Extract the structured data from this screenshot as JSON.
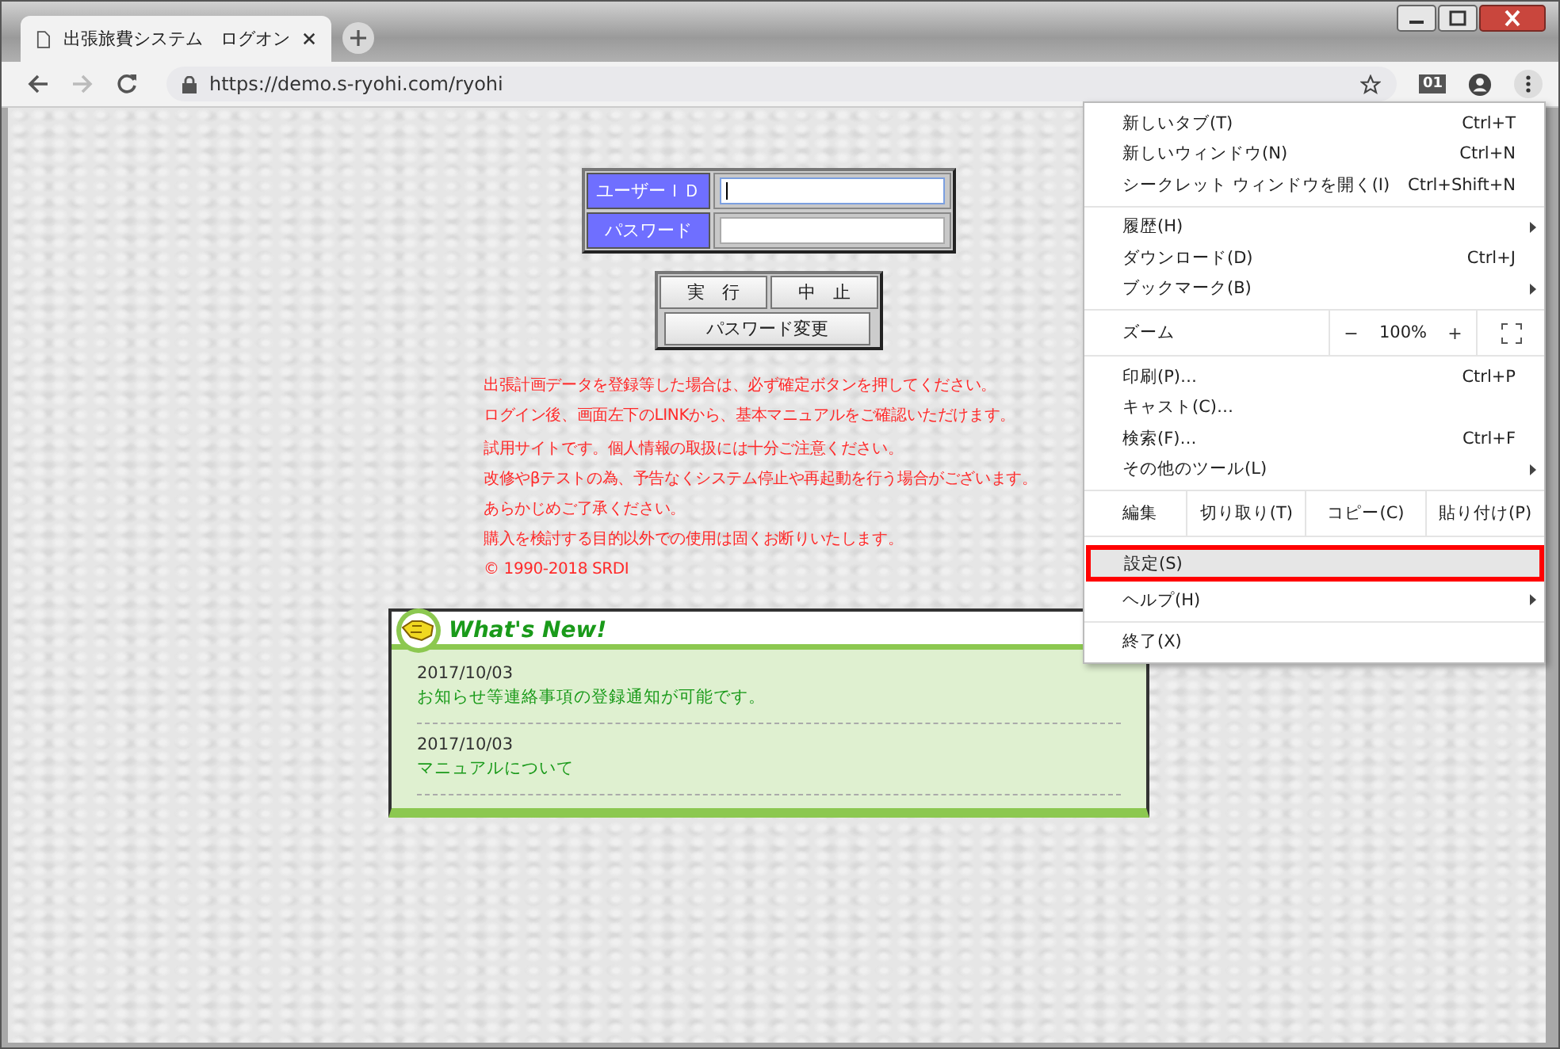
{
  "tab": {
    "title": "出張旅費システム　ログオン"
  },
  "address_bar": {
    "url": "https://demo.s-ryohi.com/ryohi"
  },
  "extension_badge": "01",
  "login_form": {
    "fields": [
      {
        "label": "ユーザーＩＤ",
        "focused": true
      },
      {
        "label": "パスワード",
        "focused": false
      }
    ],
    "buttons": [
      "実　行",
      "中　止",
      "パスワード変更"
    ]
  },
  "notices": [
    "出張計画データを登録等した場合は、必ず確定ボタンを押してください。",
    "ログイン後、画面左下のLINKから、基本マニュアルをご確認いただけます。",
    "試用サイトです。個人情報の取扱には十分ご注意ください。",
    "改修やβテストの為、予告なくシステム停止や再起動を行う場合がございます。",
    "あらかじめご了承ください。",
    "購入を検討する目的以外での使用は固くお断りいたします。",
    "© 1990-2018 SRDI"
  ],
  "whats_new": {
    "title": "What's New!",
    "entries": [
      {
        "date": "2017/10/03",
        "text": "お知らせ等連絡事項の登録通知が可能です。"
      },
      {
        "date": "2017/10/03",
        "text": "マニュアルについて"
      }
    ]
  },
  "menu": {
    "sections": [
      [
        {
          "kind": "item",
          "label": "新しいタブ(T)",
          "shortcut": "Ctrl+T",
          "submenu": false,
          "selected": false
        },
        {
          "kind": "item",
          "label": "新しいウィンドウ(N)",
          "shortcut": "Ctrl+N",
          "submenu": false,
          "selected": false
        },
        {
          "kind": "item",
          "label": "シークレット ウィンドウを開く(I)",
          "shortcut": "Ctrl+Shift+N",
          "submenu": false,
          "selected": false
        }
      ],
      [
        {
          "kind": "item",
          "label": "履歴(H)",
          "submenu": true,
          "selected": false
        },
        {
          "kind": "item",
          "label": "ダウンロード(D)",
          "shortcut": "Ctrl+J",
          "submenu": false,
          "selected": false
        },
        {
          "kind": "item",
          "label": "ブックマーク(B)",
          "submenu": true,
          "selected": false
        }
      ],
      [
        {
          "kind": "zoom",
          "label": "ズーム",
          "minus": "−",
          "value": "100%",
          "plus": "+"
        }
      ],
      [
        {
          "kind": "item",
          "label": "印刷(P)…",
          "shortcut": "Ctrl+P",
          "submenu": false,
          "selected": false
        },
        {
          "kind": "item",
          "label": "キャスト(C)…",
          "submenu": false,
          "selected": false
        },
        {
          "kind": "item",
          "label": "検索(F)…",
          "shortcut": "Ctrl+F",
          "submenu": false,
          "selected": false
        },
        {
          "kind": "item",
          "label": "その他のツール(L)",
          "submenu": true,
          "selected": false
        }
      ],
      [
        {
          "kind": "edit",
          "label": "編集",
          "buttons": [
            "切り取り(T)",
            "コピー(C)",
            "貼り付け(P)"
          ]
        }
      ],
      [
        {
          "kind": "item",
          "label": "設定(S)",
          "submenu": false,
          "selected": true
        },
        {
          "kind": "item",
          "label": "ヘルプ(H)",
          "submenu": true,
          "selected": false
        }
      ],
      [
        {
          "kind": "item",
          "label": "終了(X)",
          "submenu": false,
          "selected": false
        }
      ]
    ]
  }
}
